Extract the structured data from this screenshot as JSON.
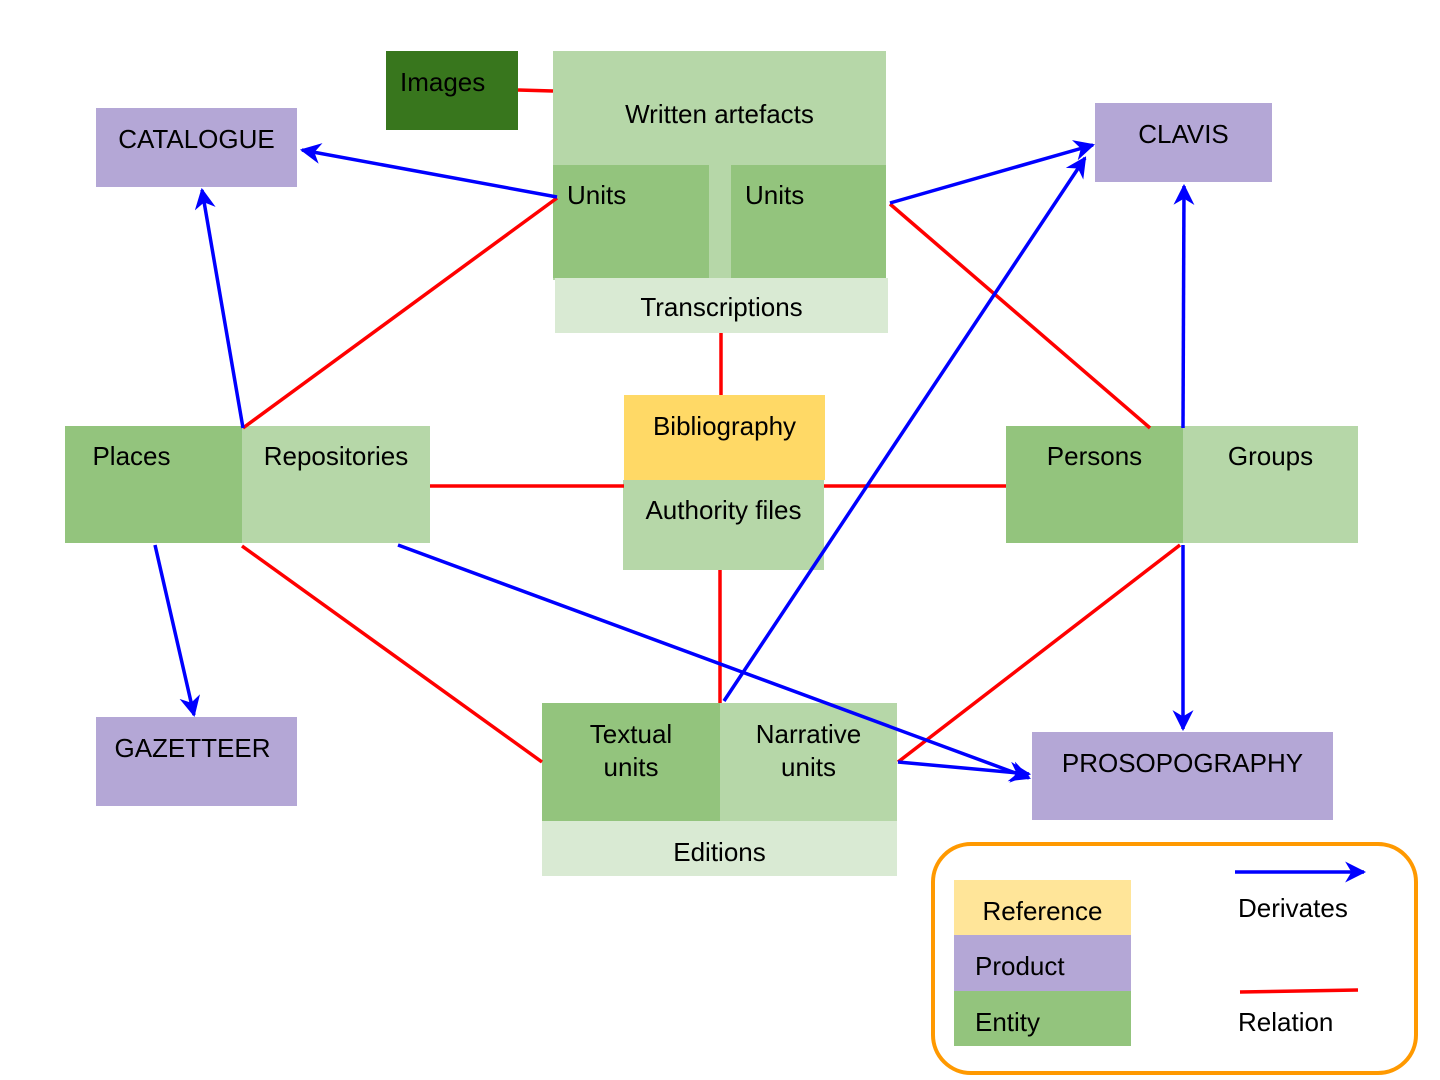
{
  "colors": {
    "reference": "#ffd966",
    "reference_legend": "#ffe599",
    "product": "#b4a7d6",
    "entity": "#93c47d",
    "entity_light": "#b6d7a8",
    "entity_lighter": "#d9ead3",
    "entity_dark": "#38761d",
    "derivates": "#0000ff",
    "relation": "#ff0000",
    "legend_border": "#ff9900"
  },
  "nodes": {
    "images": "Images",
    "written_artefacts": "Written artefacts",
    "units_left": "Units",
    "units_right": "Units",
    "transcriptions": "Transcriptions",
    "catalogue": "CATALOGUE",
    "clavis": "CLAVIS",
    "places": "Places",
    "repositories": "Repositories",
    "bibliography": "Bibliography",
    "authority_files": "Authority files",
    "persons": "Persons",
    "groups": "Groups",
    "gazetteer": "GAZETTEER",
    "textual_units_1": "Textual",
    "textual_units_2": "units",
    "narrative_units_1": "Narrative",
    "narrative_units_2": "units",
    "editions": "Editions",
    "prosopography": "PROSOPOGRAPHY"
  },
  "legend": {
    "reference": "Reference",
    "product": "Product",
    "entity": "Entity",
    "derivates": "Derivates",
    "relation": "Relation"
  },
  "edges": [
    {
      "type": "relation",
      "from": "Images",
      "to": "Written artefacts"
    },
    {
      "type": "relation",
      "from": "Units",
      "to": "Repositories"
    },
    {
      "type": "relation",
      "from": "Units",
      "to": "Persons"
    },
    {
      "type": "relation",
      "from": "Transcriptions",
      "to": "Bibliography"
    },
    {
      "type": "relation",
      "from": "Repositories",
      "to": "Authority files"
    },
    {
      "type": "relation",
      "from": "Authority files",
      "to": "Persons"
    },
    {
      "type": "relation",
      "from": "Authority files",
      "to": "Editions"
    },
    {
      "type": "relation",
      "from": "Places",
      "to": "Textual units"
    },
    {
      "type": "relation",
      "from": "Persons",
      "to": "Narrative units"
    },
    {
      "type": "derivates",
      "from": "Units",
      "to": "CATALOGUE"
    },
    {
      "type": "derivates",
      "from": "Units",
      "to": "CLAVIS"
    },
    {
      "type": "derivates",
      "from": "Places",
      "to": "CATALOGUE"
    },
    {
      "type": "derivates",
      "from": "Places",
      "to": "GAZETTEER"
    },
    {
      "type": "derivates",
      "from": "Repositories",
      "to": "PROSOPOGRAPHY"
    },
    {
      "type": "derivates",
      "from": "Narrative units",
      "to": "PROSOPOGRAPHY"
    },
    {
      "type": "derivates",
      "from": "Textual units",
      "to": "CLAVIS"
    },
    {
      "type": "derivates",
      "from": "Persons",
      "to": "CLAVIS"
    },
    {
      "type": "derivates",
      "from": "Persons",
      "to": "PROSOPOGRAPHY"
    }
  ]
}
